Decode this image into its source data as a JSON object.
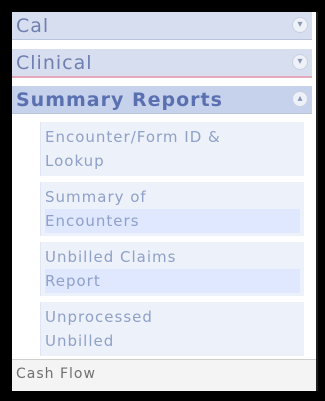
{
  "categories": [
    {
      "label": "Cal",
      "icon": "chevron-down-icon"
    },
    {
      "label": "Clinical",
      "icon": "chevron-down-icon"
    },
    {
      "label": "Summary Reports",
      "icon": "chevron-up-icon"
    }
  ],
  "summary_items": [
    {
      "line1": "Encounter/Form ID &",
      "line2": "Lookup"
    },
    {
      "line1": "Summary of",
      "line2": "Encounters"
    },
    {
      "line1": "Unbilled Claims",
      "line2": "Report"
    },
    {
      "line1": "Unprocessed",
      "line2": "Unbilled"
    }
  ],
  "footer": {
    "label": "Cash Flow"
  }
}
